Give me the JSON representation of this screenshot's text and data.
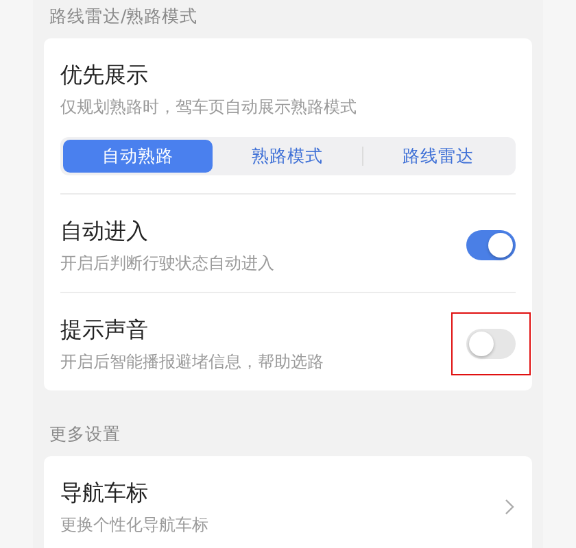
{
  "sections": [
    {
      "header": "路线雷达/熟路模式",
      "items": [
        {
          "kind": "segmented",
          "title": "优先展示",
          "subtitle": "仅规划熟路时，驾车页自动展示熟路模式",
          "options": [
            {
              "label": "自动熟路",
              "selected": true
            },
            {
              "label": "熟路模式",
              "selected": false
            },
            {
              "label": "路线雷达",
              "selected": false
            }
          ]
        },
        {
          "kind": "toggle",
          "title": "自动进入",
          "subtitle": "开启后判断行驶状态自动进入",
          "on": true,
          "highlighted": false
        },
        {
          "kind": "toggle",
          "title": "提示声音",
          "subtitle": "开启后智能播报避堵信息，帮助选路",
          "on": false,
          "highlighted": true
        }
      ]
    },
    {
      "header": "更多设置",
      "items": [
        {
          "kind": "link",
          "title": "导航车标",
          "subtitle": "更换个性化导航车标"
        }
      ]
    }
  ]
}
